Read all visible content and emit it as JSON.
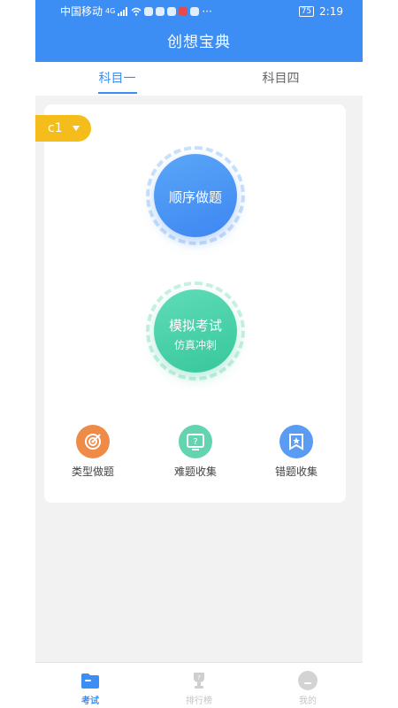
{
  "status_bar": {
    "carrier": "中国移动",
    "network": "4G",
    "battery": "75",
    "time": "2:19"
  },
  "header": {
    "title": "创想宝典"
  },
  "tabs": [
    {
      "label": "科目一",
      "active": true
    },
    {
      "label": "科目四",
      "active": false
    }
  ],
  "level_selector": {
    "value": "c1"
  },
  "main_actions": {
    "sequential": {
      "label": "顺序做题"
    },
    "mock_exam": {
      "label": "模拟考试",
      "sublabel": "仿真冲刺"
    }
  },
  "features": [
    {
      "label": "类型做题",
      "icon": "target-icon",
      "color": "#f08a47"
    },
    {
      "label": "难题收集",
      "icon": "question-board-icon",
      "color": "#63d3b0"
    },
    {
      "label": "错题收集",
      "icon": "star-banner-icon",
      "color": "#5a9cf4"
    }
  ],
  "bottom_nav": [
    {
      "label": "考试",
      "icon": "folder-icon",
      "active": true
    },
    {
      "label": "排行榜",
      "icon": "trophy-icon",
      "active": false
    },
    {
      "label": "我的",
      "icon": "profile-icon",
      "active": false
    }
  ],
  "colors": {
    "primary": "#3d8ef4",
    "accent_yellow": "#f4bd1b",
    "accent_green": "#38c79b"
  }
}
